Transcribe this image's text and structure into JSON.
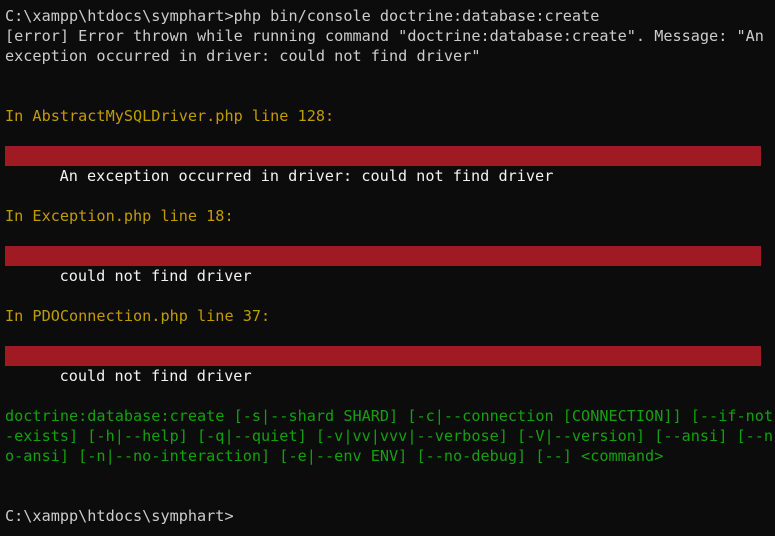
{
  "terminal": {
    "command_line": "C:\\xampp\\htdocs\\symphart>php bin/console doctrine:database:create",
    "error_line_1": "[error] Error thrown while running command \"doctrine:database:create\". Message: \"An",
    "error_line_2": "exception occurred in driver: could not find driver\"",
    "blocks": [
      {
        "location": "In AbstractMySQLDriver.php line 128:",
        "message": "An exception occurred in driver: could not find driver"
      },
      {
        "location": "In Exception.php line 18:",
        "message": "could not find driver"
      },
      {
        "location": "In PDOConnection.php line 37:",
        "message": "could not find driver"
      }
    ],
    "usage_lines": [
      "doctrine:database:create [-s|--shard SHARD] [-c|--connection [CONNECTION]] [--if-not",
      "-exists] [-h|--help] [-q|--quiet] [-v|vv|vvv|--verbose] [-V|--version] [--ansi] [--n",
      "o-ansi] [-n|--no-interaction] [-e|--env ENV] [--no-debug] [--] <command>"
    ],
    "prompt": "C:\\xampp\\htdocs\\symphart>"
  },
  "colors": {
    "background": "#0c0c0c",
    "text": "#cccccc",
    "location_text": "#c19c00",
    "error_bar": "#a01a23",
    "usage_text": "#13a10e"
  }
}
